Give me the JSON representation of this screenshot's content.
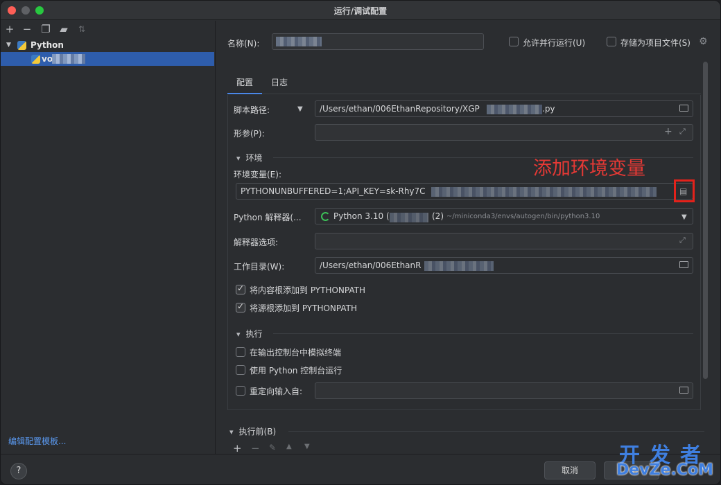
{
  "window": {
    "title": "运行/调试配置"
  },
  "left_panel": {
    "toolbar_icons": [
      "plus-icon",
      "minus-icon",
      "copy-icon",
      "folder-add-icon",
      "sort-icon"
    ],
    "tree": {
      "group_label": "Python",
      "item_label_prefix": "vo"
    },
    "footer_link": "编辑配置模板..."
  },
  "header": {
    "name_label": "名称(N):",
    "name_value": "",
    "allow_parallel_label": "允许并行运行(U)",
    "allow_parallel_checked": false,
    "store_as_file_label": "存储为项目文件(S)",
    "store_as_file_checked": false
  },
  "tabs": [
    {
      "label": "配置",
      "active": true
    },
    {
      "label": "日志",
      "active": false
    }
  ],
  "config": {
    "script_path_label": "脚本路径:",
    "script_path_value": "/Users/ethan/006EthanRepository/XGP",
    "script_path_suffix": ".py",
    "params_label": "形参(P):",
    "params_value": "",
    "env_section": "环境",
    "env_vars_label": "环境变量(E):",
    "env_vars_value": "PYTHONUNBUFFERED=1;API_KEY=sk-Rhy7C",
    "interpreter_label": "Python 解释器(...",
    "interpreter_name": "Python 3.10 (",
    "interpreter_suffix": "(2)",
    "interpreter_path": "~/miniconda3/envs/autogen/bin/python3.10",
    "interpreter_options_label": "解释器选项:",
    "interpreter_options_value": "",
    "workdir_label": "工作目录(W):",
    "workdir_value": "/Users/ethan/006EthanR",
    "add_content_roots_label": "将内容根添加到 PYTHONPATH",
    "add_content_roots_checked": true,
    "add_source_roots_label": "将源根添加到 PYTHONPATH",
    "add_source_roots_checked": true,
    "exec_section": "执行",
    "emulate_terminal_label": "在输出控制台中模拟终端",
    "emulate_terminal_checked": false,
    "python_console_label": "使用 Python 控制台运行",
    "python_console_checked": false,
    "redirect_input_label": "重定向输入自:",
    "redirect_input_checked": false,
    "redirect_input_value": ""
  },
  "before_launch": {
    "section": "执行前(B)"
  },
  "annotation": {
    "text": "添加环境变量",
    "color": "#e53935"
  },
  "footer": {
    "help_label": "?",
    "cancel_label": "取消"
  },
  "watermark": {
    "top": "开发者",
    "bottom": "DevZe.CoM"
  }
}
